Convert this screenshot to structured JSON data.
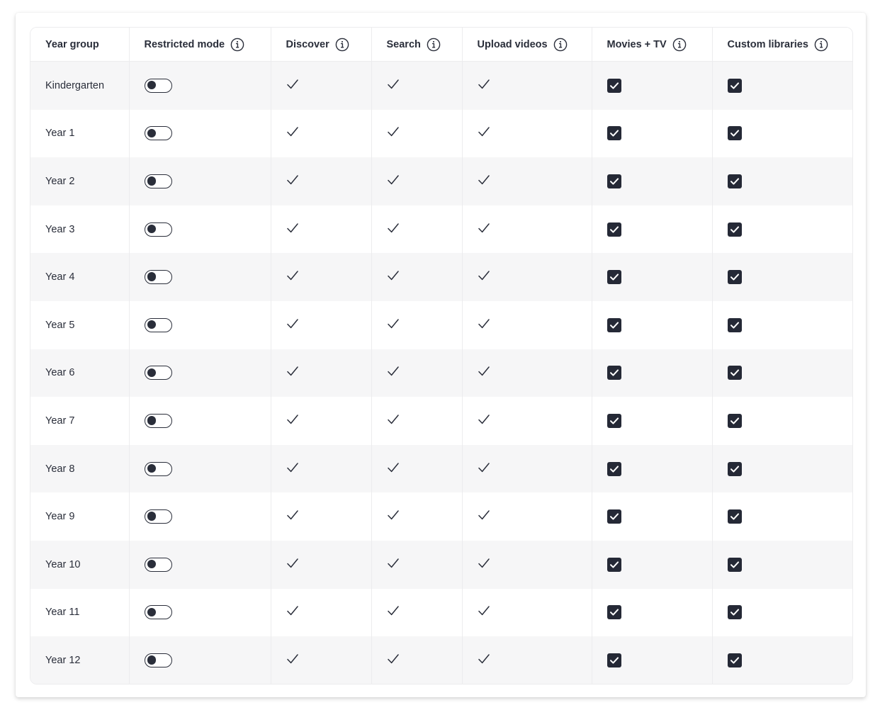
{
  "table": {
    "columns": [
      {
        "key": "year_group",
        "label": "Year group",
        "info": false
      },
      {
        "key": "restricted_mode",
        "label": "Restricted mode",
        "info": true
      },
      {
        "key": "discover",
        "label": "Discover",
        "info": true
      },
      {
        "key": "search",
        "label": "Search",
        "info": true
      },
      {
        "key": "upload_videos",
        "label": "Upload videos",
        "info": true
      },
      {
        "key": "movies_tv",
        "label": "Movies + TV",
        "info": true
      },
      {
        "key": "custom_libraries",
        "label": "Custom libraries",
        "info": true
      }
    ],
    "rows": [
      {
        "year_group": "Kindergarten",
        "restricted_mode": false,
        "discover": true,
        "search": true,
        "upload_videos": true,
        "movies_tv": true,
        "custom_libraries": true
      },
      {
        "year_group": "Year 1",
        "restricted_mode": false,
        "discover": true,
        "search": true,
        "upload_videos": true,
        "movies_tv": true,
        "custom_libraries": true
      },
      {
        "year_group": "Year 2",
        "restricted_mode": false,
        "discover": true,
        "search": true,
        "upload_videos": true,
        "movies_tv": true,
        "custom_libraries": true
      },
      {
        "year_group": "Year 3",
        "restricted_mode": false,
        "discover": true,
        "search": true,
        "upload_videos": true,
        "movies_tv": true,
        "custom_libraries": true
      },
      {
        "year_group": "Year 4",
        "restricted_mode": false,
        "discover": true,
        "search": true,
        "upload_videos": true,
        "movies_tv": true,
        "custom_libraries": true
      },
      {
        "year_group": "Year 5",
        "restricted_mode": false,
        "discover": true,
        "search": true,
        "upload_videos": true,
        "movies_tv": true,
        "custom_libraries": true
      },
      {
        "year_group": "Year 6",
        "restricted_mode": false,
        "discover": true,
        "search": true,
        "upload_videos": true,
        "movies_tv": true,
        "custom_libraries": true
      },
      {
        "year_group": "Year 7",
        "restricted_mode": false,
        "discover": true,
        "search": true,
        "upload_videos": true,
        "movies_tv": true,
        "custom_libraries": true
      },
      {
        "year_group": "Year 8",
        "restricted_mode": false,
        "discover": true,
        "search": true,
        "upload_videos": true,
        "movies_tv": true,
        "custom_libraries": true
      },
      {
        "year_group": "Year 9",
        "restricted_mode": false,
        "discover": true,
        "search": true,
        "upload_videos": true,
        "movies_tv": true,
        "custom_libraries": true
      },
      {
        "year_group": "Year 10",
        "restricted_mode": false,
        "discover": true,
        "search": true,
        "upload_videos": true,
        "movies_tv": true,
        "custom_libraries": true
      },
      {
        "year_group": "Year 11",
        "restricted_mode": false,
        "discover": true,
        "search": true,
        "upload_videos": true,
        "movies_tv": true,
        "custom_libraries": true
      },
      {
        "year_group": "Year 12",
        "restricted_mode": false,
        "discover": true,
        "search": true,
        "upload_videos": true,
        "movies_tv": true,
        "custom_libraries": true
      }
    ]
  },
  "icons": {
    "info": "info-circle-icon",
    "check": "checkmark-icon",
    "checkbox": "checkbox-checked-icon",
    "toggle": "toggle-switch"
  },
  "colors": {
    "text": "#2a2e3a",
    "row_alt": "#f6f6f7",
    "border": "#ececee",
    "control_dark": "#252936"
  }
}
